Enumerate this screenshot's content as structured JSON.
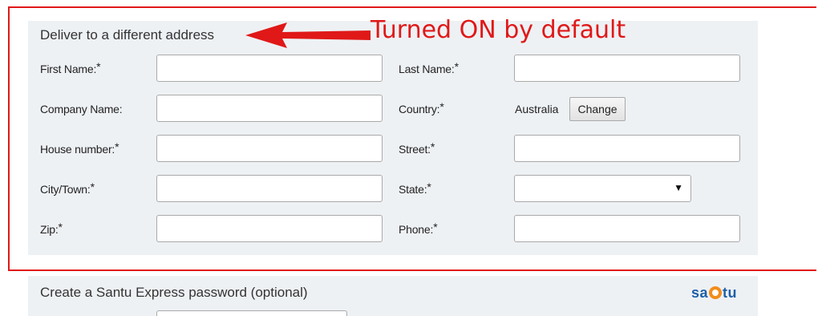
{
  "form": {
    "section_title": "Deliver to a different address",
    "annotation": "Turned ON by default",
    "fields": {
      "first_name": "First Name:",
      "last_name": "Last Name:",
      "company_name": "Company Name:",
      "country": "Country:",
      "house_number": "House number:",
      "street": "Street:",
      "city_town": "City/Town:",
      "state": "State:",
      "zip": "Zip:",
      "phone": "Phone:"
    },
    "required_mark": "*",
    "country_value": "Australia",
    "change_label": "Change"
  },
  "password_section": {
    "title": "Create a Santu Express password (optional)",
    "brand_left": "sa",
    "brand_right": "tu"
  },
  "colors": {
    "annotation_red": "#e01818",
    "panel_bg": "#eef1f4",
    "brand_blue": "#1d5fa8",
    "brand_orange": "#f28c1b"
  },
  "icons": {
    "annotation_arrow": "arrow-left-icon",
    "select_arrow": "caret-down-icon",
    "brand_mark": "santu-logo-mark-icon"
  }
}
